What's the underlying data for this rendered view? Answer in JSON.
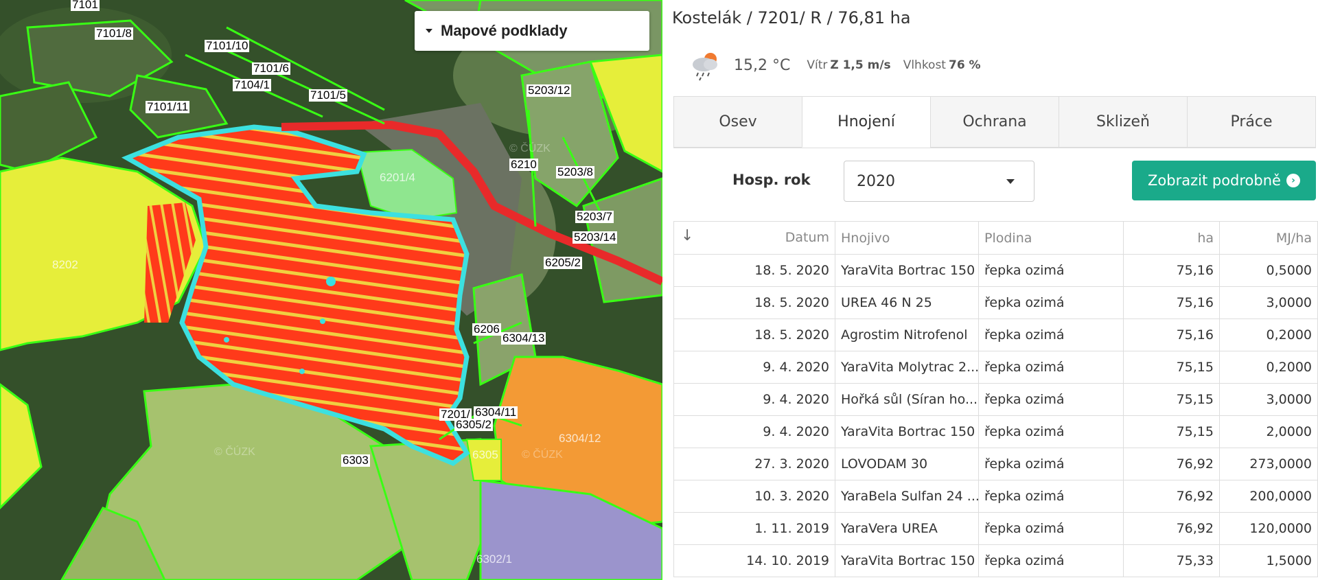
{
  "map": {
    "layers_button": "Mapové podklady",
    "watermark": "© ČÚZK",
    "parcels": [
      {
        "label": "7101"
      },
      {
        "label": "7101/8"
      },
      {
        "label": "7101/10"
      },
      {
        "label": "7101/6"
      },
      {
        "label": "7104/1"
      },
      {
        "label": "7101/5"
      },
      {
        "label": "7101/11"
      },
      {
        "label": "5203/12"
      },
      {
        "label": "6210"
      },
      {
        "label": "5203/8"
      },
      {
        "label": "6201/4"
      },
      {
        "label": "5203/7"
      },
      {
        "label": "5203/14"
      },
      {
        "label": "6205/2"
      },
      {
        "label": "8202"
      },
      {
        "label": "6206"
      },
      {
        "label": "6304/13"
      },
      {
        "label": "7201/"
      },
      {
        "label": "6304/11"
      },
      {
        "label": "6305/2"
      },
      {
        "label": "6304/12"
      },
      {
        "label": "6303"
      },
      {
        "label": "6305"
      },
      {
        "label": "6302/1"
      }
    ]
  },
  "panel": {
    "title": "Kostelák / 7201/ R / 76,81 ha",
    "weather": {
      "icon": "rain-cloud-sun-icon",
      "temperature": "15,2 °C",
      "wind_label": "Vítr",
      "wind_value": "Z 1,5 m/s",
      "humidity_label": "Vlhkost",
      "humidity_value": "76 %"
    },
    "tabs": [
      {
        "label": "Osev",
        "active": false
      },
      {
        "label": "Hnojení",
        "active": true
      },
      {
        "label": "Ochrana",
        "active": false
      },
      {
        "label": "Sklizeň",
        "active": false
      },
      {
        "label": "Práce",
        "active": false
      }
    ],
    "filter": {
      "label": "Hosp. rok",
      "selected": "2020"
    },
    "detail_button": "Zobrazit podrobně",
    "table": {
      "sort_icon": "↓",
      "columns": [
        "Datum",
        "Hnojivo",
        "Plodina",
        "ha",
        "MJ/ha"
      ],
      "rows": [
        [
          "18. 5. 2020",
          "YaraVita Bortrac 150",
          "řepka ozimá",
          "75,16",
          "0,5000"
        ],
        [
          "18. 5. 2020",
          "UREA 46 N 25",
          "řepka ozimá",
          "75,16",
          "3,0000"
        ],
        [
          "18. 5. 2020",
          "Agrostim Nitrofenol",
          "řepka ozimá",
          "75,16",
          "0,2000"
        ],
        [
          "9. 4. 2020",
          "YaraVita Molytrac 2...",
          "řepka ozimá",
          "75,15",
          "0,2000"
        ],
        [
          "9. 4. 2020",
          "Hořká sůl (Síran ho...",
          "řepka ozimá",
          "75,15",
          "3,0000"
        ],
        [
          "9. 4. 2020",
          "YaraVita Bortrac 150",
          "řepka ozimá",
          "75,15",
          "2,0000"
        ],
        [
          "27. 3. 2020",
          "LOVODAM 30",
          "řepka ozimá",
          "76,92",
          "273,0000"
        ],
        [
          "10. 3. 2020",
          "YaraBela Sulfan 24 ...",
          "řepka ozimá",
          "76,92",
          "200,0000"
        ],
        [
          "1. 11. 2019",
          "YaraVera UREA",
          "řepka ozimá",
          "76,92",
          "120,0000"
        ],
        [
          "14. 10. 2019",
          "YaraVita Bortrac 150",
          "řepka ozimá",
          "75,33",
          "1,5000"
        ]
      ]
    }
  }
}
